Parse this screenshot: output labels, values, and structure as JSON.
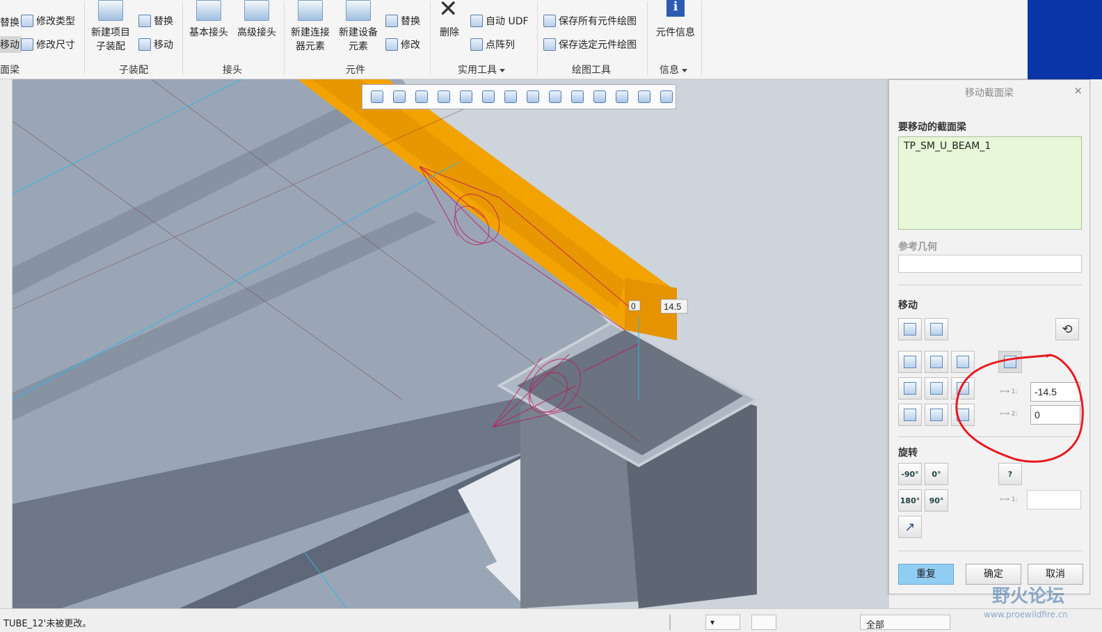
{
  "ribbon": {
    "left_fragments": [
      "替换",
      "移动"
    ],
    "left_group_label": "面梁",
    "group_a_items": [
      "修改类型",
      "修改尺寸"
    ],
    "subasm": {
      "new_item_l1": "新建项目",
      "new_item_l2": "子装配",
      "replace": "替换",
      "move": "移动",
      "label": "子装配"
    },
    "joints": {
      "basic": "基本接头",
      "advanced": "高级接头",
      "label": "接头"
    },
    "elements": {
      "conn_l1": "新建连接",
      "conn_l2": "器元素",
      "dev_l1": "新建设备",
      "dev_l2": "元素",
      "replace": "替换",
      "modify": "修改",
      "label": "元件"
    },
    "utilities": {
      "delete": "删除",
      "auto_udf": "自动 UDF",
      "point_array": "点阵列",
      "label": "实用工具"
    },
    "drawing": {
      "save_all": "保存所有元件绘图",
      "save_selected": "保存选定元件绘图",
      "label": "绘图工具"
    },
    "info": {
      "element_info": "元件信息",
      "label": "信息"
    }
  },
  "viewport": {
    "toolbar_icons": [
      "zoom-fit-icon",
      "zoom-in-icon",
      "zoom-out-icon",
      "repaint-icon",
      "spin-icon",
      "view-orient-icon",
      "saved-views-icon",
      "camera-icon",
      "display-style-icon",
      "datum-display-icon",
      "annotation-icon",
      "spin-center-icon",
      "point-display-icon",
      "csys-icon"
    ],
    "dim_left": "0",
    "dim_right": "14.5"
  },
  "dialog": {
    "title": "移动截面梁",
    "close": "×",
    "beam_label": "要移动的截面梁",
    "beam_value": "TP_SM_U_BEAM_1",
    "ref_label": "参考几何",
    "move_label": "移动",
    "dim1_label": "1:",
    "dim1_value": "-14.5",
    "dim2_label": "2:",
    "dim2_value": "0",
    "rotate_label": "旋转",
    "rot_m90": "-90°",
    "rot_0": "0°",
    "rot_q": "?",
    "rot_180": "180°",
    "rot_90": "90°",
    "rot_dim_label": "1:",
    "repeat": "重复",
    "ok": "确定",
    "cancel": "取消"
  },
  "status": {
    "message": "TUBE_12'未被更改。",
    "filter": "全部"
  },
  "watermark": {
    "line1": "野火论坛",
    "line2": "www.proewildfire.cn"
  }
}
